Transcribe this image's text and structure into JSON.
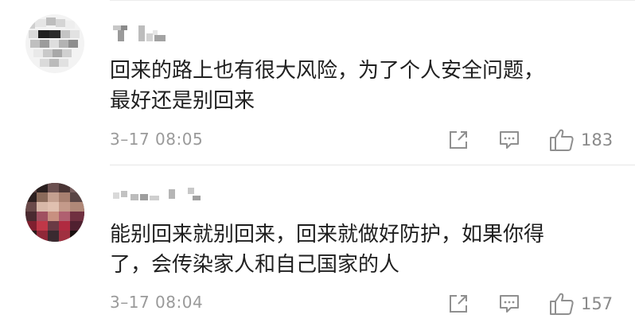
{
  "comments": [
    {
      "lines": [
        "回来的路上也有很大风险，为了个人安全问题，",
        "最好还是别回来"
      ],
      "time": "3–17 08:05",
      "likes": "183",
      "icons": {
        "share": "share-out-icon",
        "reply": "comment-bubble-icon",
        "like": "thumbs-up-icon"
      }
    },
    {
      "lines": [
        "能别回来就别回来，回来就做好防护，如果你得",
        "了，会传染家人和自己国家的人"
      ],
      "time": "3–17 08:04",
      "likes": "157",
      "icons": {
        "share": "share-out-icon",
        "reply": "comment-bubble-icon",
        "like": "thumbs-up-icon"
      }
    }
  ],
  "colors": {
    "text": "#1f1f1f",
    "meta": "#9a9a9a",
    "icon": "#8f8f8f",
    "divider": "#e6e6e6"
  }
}
